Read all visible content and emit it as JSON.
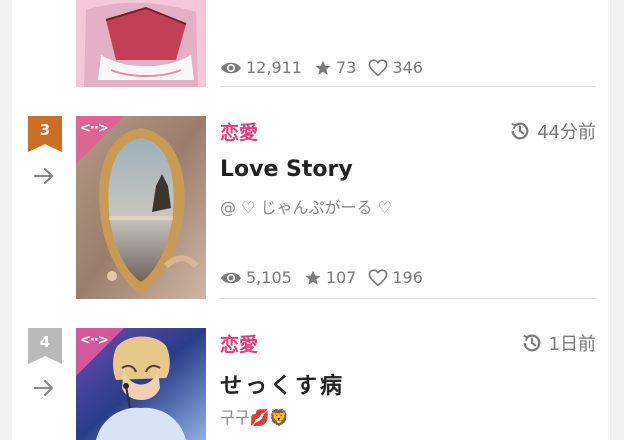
{
  "items": [
    {
      "rank": "",
      "genre": "",
      "time": "",
      "title": "",
      "author": "",
      "views": "12,911",
      "stars": "73",
      "likes": "346",
      "colors": {
        "badge": "#cc7a2a"
      }
    },
    {
      "rank": "3",
      "genre": "恋愛",
      "time": "44分前",
      "title": "Love Story",
      "author": "@ ♡ じゃんぷがーる ♡",
      "views": "5,105",
      "stars": "107",
      "likes": "196",
      "colors": {
        "badge": "#cc6f24"
      }
    },
    {
      "rank": "4",
      "genre": "恋愛",
      "time": "1日前",
      "title": "せっくす病",
      "author": "구구💋🦁",
      "views": "",
      "stars": "",
      "likes": "",
      "colors": {
        "badge": "#b9b9b9"
      }
    }
  ],
  "colors": {
    "accent": "#e53a7e",
    "muted": "#7a7a7a"
  },
  "icons": {
    "view": "eye-icon",
    "star": "star-icon",
    "like": "heart-icon",
    "time": "clock-history-icon",
    "arrow": "arrow-right-icon"
  }
}
